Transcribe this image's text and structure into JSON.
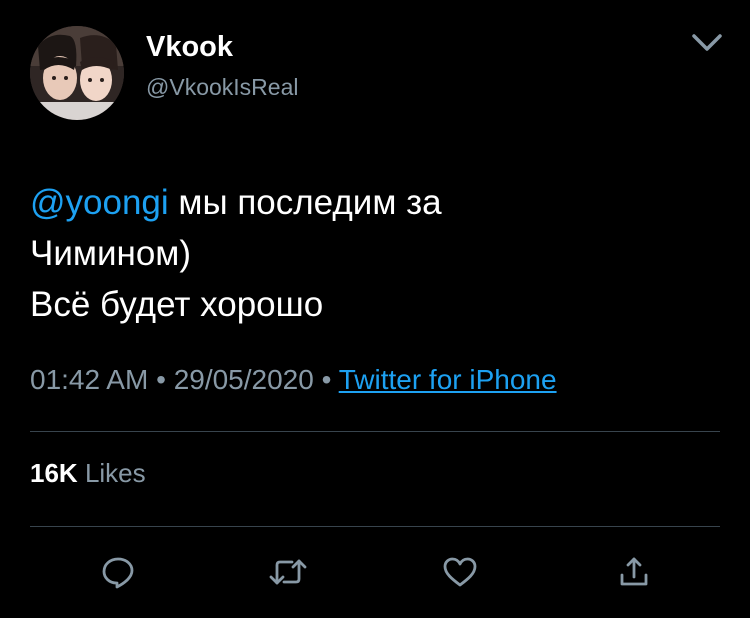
{
  "author": {
    "display_name": "Vkook",
    "handle": "@VkookIsReal",
    "avatar_icon": "profile-photo"
  },
  "tweet": {
    "mention": "@yoongi",
    "line1_rest": " мы последим за",
    "line2": "Чимином)",
    "line3": "Всё будет хорошо"
  },
  "meta": {
    "time": "01:42 AM",
    "separator": " • ",
    "date": "29/05/2020",
    "source": "Twitter for iPhone"
  },
  "stats": {
    "likes_count": "16K",
    "likes_label": "Likes"
  },
  "actions": [
    {
      "name": "reply",
      "icon": "reply-icon"
    },
    {
      "name": "retweet",
      "icon": "retweet-icon"
    },
    {
      "name": "like",
      "icon": "heart-icon"
    },
    {
      "name": "share",
      "icon": "share-icon"
    }
  ],
  "colors": {
    "background": "#000000",
    "text": "#ffffff",
    "secondary": "#8899a6",
    "accent": "#1da1f2",
    "divider": "#38444d"
  }
}
